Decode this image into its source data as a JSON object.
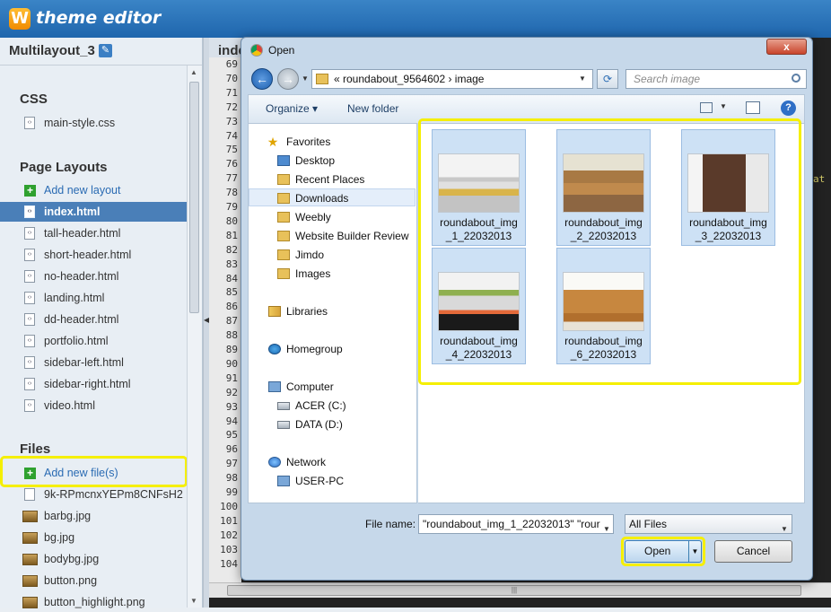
{
  "app": {
    "logo_letter": "W",
    "title": "theme editor"
  },
  "sidebar": {
    "site_title": "Multilayout_3",
    "css_heading": "CSS",
    "css_files": [
      "main-style.css"
    ],
    "layouts_heading": "Page Layouts",
    "add_layout": "Add new layout",
    "layouts": [
      "index.html",
      "tall-header.html",
      "short-header.html",
      "no-header.html",
      "landing.html",
      "dd-header.html",
      "portfolio.html",
      "sidebar-left.html",
      "sidebar-right.html",
      "video.html"
    ],
    "active_layout": "index.html",
    "files_heading": "Files",
    "add_file": "Add new file(s)",
    "files": [
      "9k-RPmcnxYEPm8CNFsH2",
      "barbg.jpg",
      "bg.jpg",
      "bodybg.jpg",
      "button.png",
      "button_highlight.png"
    ]
  },
  "code": {
    "tab_label": "inde",
    "line_numbers": [
      "69",
      "70",
      "71",
      "72",
      "73",
      "74",
      "75",
      "76",
      "77",
      "78",
      "79",
      "80",
      "81",
      "82",
      "83",
      "84",
      "85",
      "86",
      "87",
      "88",
      "89",
      "90",
      "91",
      "92",
      "93",
      "94",
      "95",
      "96",
      "97",
      "98",
      "99",
      "100",
      "101",
      "102",
      "103",
      "104"
    ],
    "hint": "at"
  },
  "dialog": {
    "title": "Open",
    "close_label": "x",
    "address": "«  roundabout_9564602  ›  image",
    "search_placeholder": "Search image",
    "organize": "Organize ▾",
    "new_folder": "New folder",
    "nav": {
      "favorites": "Favorites",
      "desktop": "Desktop",
      "recent_places": "Recent Places",
      "downloads": "Downloads",
      "weebly": "Weebly",
      "website_builder_review": "Website Builder Review",
      "jimdo": "Jimdo",
      "images": "Images",
      "libraries": "Libraries",
      "homegroup": "Homegroup",
      "computer": "Computer",
      "acer": "ACER (C:)",
      "data": "DATA (D:)",
      "network": "Network",
      "user_pc": "USER-PC"
    },
    "files": [
      {
        "line1": "roundabout_img",
        "line2": "_1_22032013"
      },
      {
        "line1": "roundabout_img",
        "line2": "_2_22032013"
      },
      {
        "line1": "roundabout_img",
        "line2": "_3_22032013"
      },
      {
        "line1": "roundabout_img",
        "line2": "_4_22032013"
      },
      {
        "line1": "roundabout_img",
        "line2": "_6_22032013"
      }
    ],
    "file_name_label": "File name:",
    "file_name_value": "\"roundabout_img_1_22032013\" \"rour",
    "file_type": "All Files",
    "open_label": "Open",
    "cancel_label": "Cancel"
  },
  "colors": {
    "highlight": "#f5ef00",
    "header": "#1f66ad",
    "active_row": "#4a7fb8"
  }
}
